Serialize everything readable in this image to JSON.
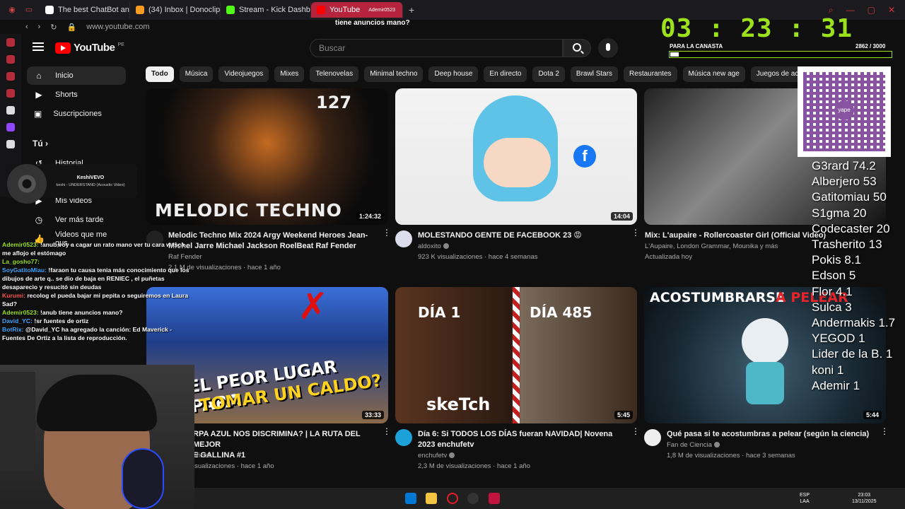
{
  "browser": {
    "tabs": [
      {
        "label": "The best ChatBot and"
      },
      {
        "label": "(34) Inbox | Donoclip"
      },
      {
        "label": "Stream - Kick Dashboard"
      },
      {
        "label": "YouTube"
      }
    ],
    "address": "www.youtube.com"
  },
  "header": {
    "logo": "YouTube",
    "country": "PE",
    "search_placeholder": "Buscar"
  },
  "sidebar": {
    "items": [
      {
        "label": "Inicio"
      },
      {
        "label": "Shorts"
      },
      {
        "label": "Suscripciones"
      }
    ],
    "you_heading": "Tú",
    "you_items": [
      {
        "label": "Historial"
      },
      {
        "label": "Mis videos"
      },
      {
        "label": "Ver más tarde"
      },
      {
        "label": "Videos que me gus..."
      }
    ],
    "subs_heading": "Suscripciones"
  },
  "chips": [
    "Todo",
    "Música",
    "Videojuegos",
    "Mixes",
    "Telenovelas",
    "Minimal techno",
    "Deep house",
    "En directo",
    "Dota 2",
    "Brawl Stars",
    "Restaurantes",
    "Música new age",
    "Juegos de acción y av"
  ],
  "videos": [
    {
      "title": "Melodic Techno  Mix 2024  Argy Weekend Heroes Jean-Michel Jarre Michael Jackson RoelBeat Raf Fender",
      "channel": "Raf Fender",
      "stats": "2,1 M de visualizaciones · hace 1 año",
      "duration": "1:24:32",
      "thumb_text": "MELODIC TECHNO",
      "thumb_num": "127"
    },
    {
      "title": "MOLESTANDO GENTE DE FACEBOOK 23 😡",
      "channel": "aldoxito",
      "stats": "923 K visualizaciones · hace 4 semanas",
      "duration": "14:04"
    },
    {
      "title": "Mix: L'aupaire - Rollercoaster Girl (Official Video)",
      "channel": "L'Aupaire, London Grammar, Mounika y más",
      "stats": "Actualizada hoy",
      "duration": ""
    },
    {
      "title": "RPA AZUL NOS DISCRIMINA? | LA RUTA DEL MEJOR",
      "title2": "E GALLINA #1",
      "channel": "oficial",
      "stats": "isualizaciones · hace 1 año",
      "duration": "33:33",
      "thumb_text": "EL PEOR LUGAR PARA",
      "thumb_text2": "TOMAR UN CALDO?"
    },
    {
      "title": "Día 6: Si TODOS LOS DÍAS fueran NAVIDAD| Novena 2023 enchufetv",
      "channel": "enchufetv",
      "stats": "2,3 M de visualizaciones · hace 1 año",
      "duration": "5:45",
      "thumb_text": "DÍA 1",
      "thumb_text2": "DÍA 485",
      "thumb_logo": "skeTch"
    },
    {
      "title": "Qué pasa si te acostumbras a pelear (según la ciencia)",
      "channel": "Fan de Ciencia",
      "stats": "1,8 M de visualizaciones · hace 3 semanas",
      "duration": "5:44",
      "thumb_text": "ACOSTUMBRARSE",
      "thumb_text2": "A PELEAR"
    }
  ],
  "overlay": {
    "timer": "03 : 23 : 31",
    "canasta_label": "PARA LA CANASTA",
    "canasta_value": "2862 / 3000",
    "canasta_progress": 0.01,
    "leaderboard": [
      "G3rard 74.2",
      "Alberjero 53",
      "Gatitomiau 50",
      "S1gma 20",
      "Codecaster 20",
      "Trasherito 13",
      "Pokis 8.1",
      "Edson 5",
      "Flor 4.1",
      "Sulca 3",
      "Andermakis 1.7",
      "YEGOD 1",
      "Lider de la B. 1",
      "koni 1",
      "Ademir 1"
    ],
    "now_playing_artist": "KeshiVEVO",
    "now_playing_song": "keshi - UNDERSTAND (Acoustic Video)",
    "top_chat": "tiene anuncios mano?",
    "top_chat_user": "Ademir0523",
    "chat": [
      {
        "user": "Ademir0523:",
        "text": " !anub voy a cagar un rato mano ver tu cara wasca me aflojo el estómago"
      },
      {
        "user": "La_gosho77:",
        "text": " "
      },
      {
        "user": "SoyGatitoMiau:",
        "text": " !faraon tu causa tenia más conocimiento que los dibujos de arte q.. se dio de baja en RENIEC , el puñetas desaparecio y resucitó sin deudas"
      },
      {
        "user": "Kurumi:",
        "text": " recolog el pueda bajar mi pepita o seguiremos en Laura Sad?"
      },
      {
        "user": "Ademir0523:",
        "text": " !anub tiene anuncios mano?"
      },
      {
        "user": "David_YC:",
        "text": " !sr fuentes de ortiz"
      },
      {
        "user": "BotRix:",
        "text": " @David_YC ha agregado la canción: Ed Maverick - Fuentes De Ortiz a la lista de reproducción."
      }
    ]
  },
  "taskbar": {
    "lang": "ESP",
    "lang2": "LAA",
    "time": "23:03",
    "date": "13/11/2025"
  }
}
